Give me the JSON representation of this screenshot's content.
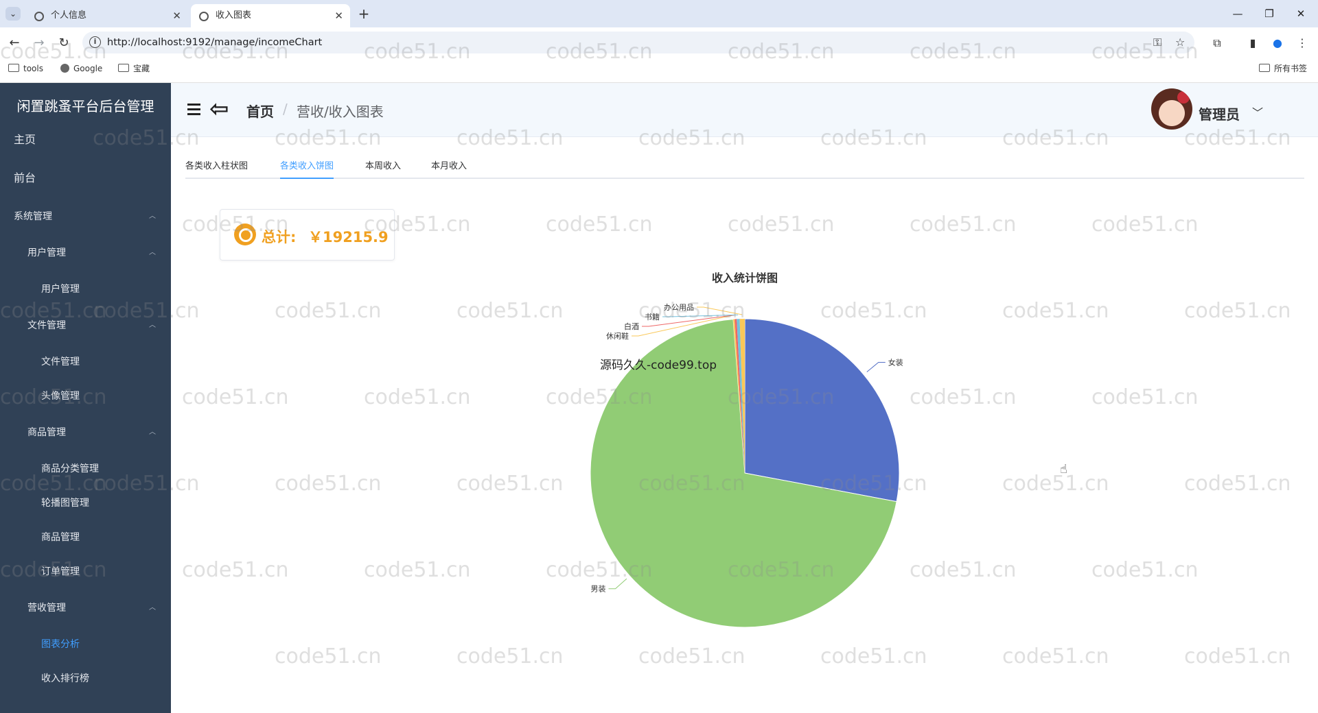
{
  "browser": {
    "tabs": [
      {
        "title": "个人信息"
      },
      {
        "title": "收入图表"
      }
    ],
    "url": "http://localhost:9192/manage/incomeChart",
    "bookmarks": [
      "tools",
      "Google",
      "宝藏"
    ],
    "all_bookmarks_label": "所有书签"
  },
  "sidebar": {
    "title": "闲置跳蚤平台后台管理",
    "items": [
      {
        "label": "主页"
      },
      {
        "label": "前台"
      },
      {
        "label": "系统管理"
      },
      {
        "label": "用户管理"
      },
      {
        "label": "用户管理"
      },
      {
        "label": "文件管理"
      },
      {
        "label": "文件管理"
      },
      {
        "label": "头像管理"
      },
      {
        "label": "商品管理"
      },
      {
        "label": "商品分类管理"
      },
      {
        "label": "轮播图管理"
      },
      {
        "label": "商品管理"
      },
      {
        "label": "订单管理"
      },
      {
        "label": "营收管理"
      },
      {
        "label": "图表分析"
      },
      {
        "label": "收入排行榜"
      }
    ]
  },
  "header": {
    "breadcrumb_home": "首页",
    "breadcrumb_sep": "/",
    "breadcrumb_current": "营收/收入图表",
    "user_name": "管理员"
  },
  "tabs": [
    {
      "label": "各类收入柱状图"
    },
    {
      "label": "各类收入饼图"
    },
    {
      "label": "本周收入"
    },
    {
      "label": "本月收入"
    }
  ],
  "summary": {
    "label": "总计:",
    "value": "￥19215.9"
  },
  "overlay_text": "源码久久-code99.top",
  "watermark_text": "code51.cn",
  "chart_data": {
    "type": "pie",
    "title": "收入统计饼图",
    "series": [
      {
        "name": "女装",
        "value": 5373,
        "color": "#5470c6"
      },
      {
        "name": "男装",
        "value": 13612,
        "color": "#91cc75"
      },
      {
        "name": "休闲鞋",
        "value": 30,
        "color": "#fac858"
      },
      {
        "name": "白酒",
        "value": 40,
        "color": "#ee6666"
      },
      {
        "name": "书籍",
        "value": 60,
        "color": "#73c0de"
      },
      {
        "name": "办公用品",
        "value": 100.9,
        "color": "#fac858"
      }
    ]
  }
}
